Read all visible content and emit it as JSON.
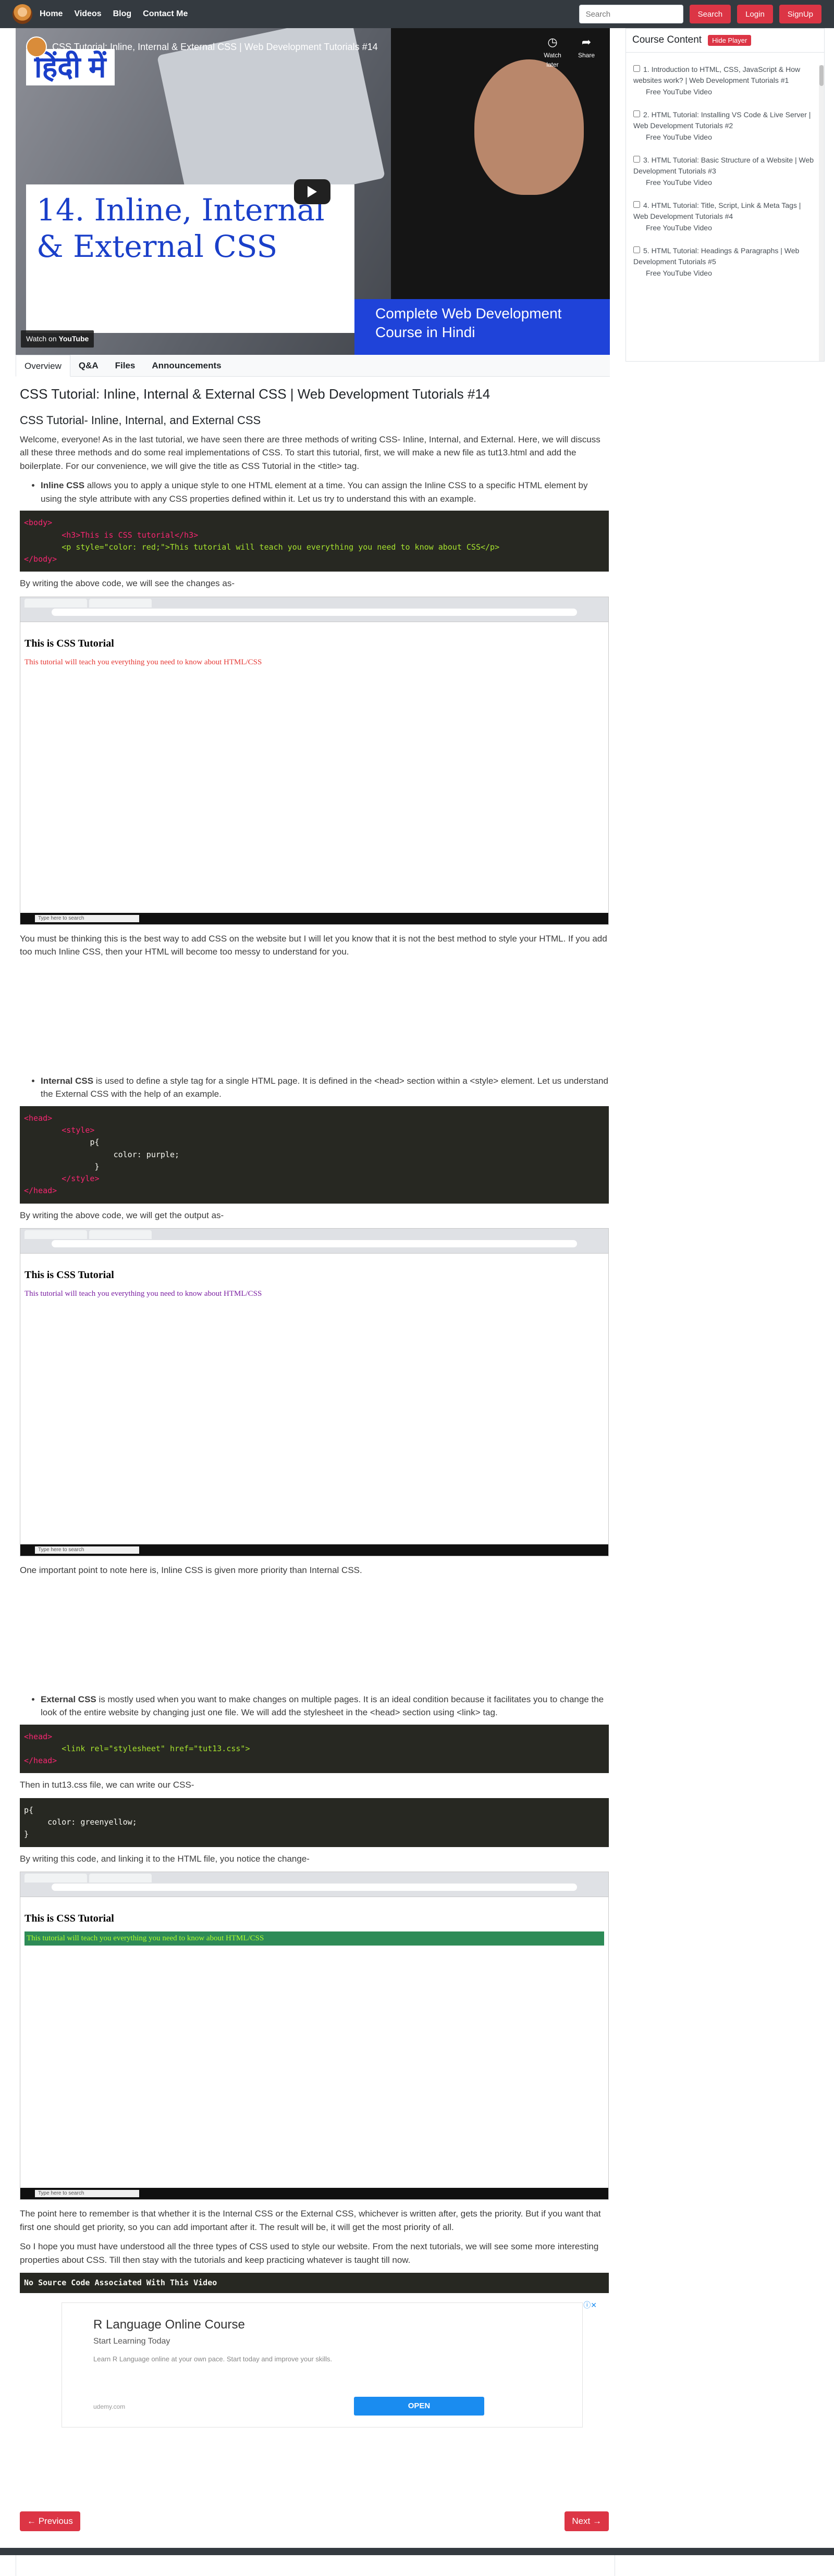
{
  "nav": {
    "links": [
      "Home",
      "Videos",
      "Blog",
      "Contact Me"
    ],
    "search_placeholder": "Search",
    "search_button": "Search",
    "login_button": "Login",
    "signup_button": "SignUp"
  },
  "video": {
    "overlay_title": "CSS Tutorial: Inline, Internal & External CSS | Web Development Tutorials #14",
    "hindi_tag": "हिंदी में",
    "big_title": "14. Inline, Internal & External CSS",
    "course_hindi": "Complete Web Development Course in Hindi",
    "watch_on": "Watch on",
    "youtube": "YouTube",
    "watch_later": "Watch later",
    "share": "Share"
  },
  "sidebar": {
    "title": "Course Content",
    "hide_button": "Hide Player",
    "lessons": [
      {
        "title": "1. Introduction to HTML, CSS, JavaScript & How websites work? | Web Development Tutorials #1",
        "sub": "Free YouTube Video"
      },
      {
        "title": "2. HTML Tutorial: Installing VS Code & Live Server | Web Development Tutorials #2",
        "sub": "Free YouTube Video"
      },
      {
        "title": "3. HTML Tutorial: Basic Structure of a Website | Web Development Tutorials #3",
        "sub": "Free YouTube Video"
      },
      {
        "title": "4. HTML Tutorial: Title, Script, Link & Meta Tags | Web Development Tutorials #4",
        "sub": "Free YouTube Video"
      },
      {
        "title": "5. HTML Tutorial: Headings & Paragraphs | Web Development Tutorials #5",
        "sub": "Free YouTube Video"
      }
    ]
  },
  "tabs": [
    "Overview",
    "Q&A",
    "Files",
    "Announcements"
  ],
  "article": {
    "title": "CSS Tutorial: Inline, Internal & External CSS | Web Development Tutorials #14",
    "subtitle": "CSS Tutorial- Inline, Internal, and External CSS",
    "intro": "Welcome, everyone! As in the last tutorial, we have seen there are three methods of writing CSS- Inline, Internal, and External. Here, we will discuss all these three methods and do some real implementations of CSS. To start this tutorial, first, we will make a new file as tut13.html and add the boilerplate. For our convenience, we will give the title as CSS Tutorial in the <title> tag.",
    "inline_bold": "Inline CSS",
    "inline_text": " allows you to apply a unique style to one HTML element at a time. You can assign the Inline CSS to a specific HTML element by using the style attribute with any CSS properties defined within it. Let us try to understand this with an example.",
    "code1": [
      "<body>",
      "<h3>This is CSS tutorial</h3>",
      "<p style=\"color: red;\">This tutorial will teach you everything you need to know about CSS</p>",
      "</body>"
    ],
    "after_code1": "By writing the above code, we will see the changes as-",
    "shot1_h": "This is CSS Tutorial",
    "shot1_p": "This tutorial will teach you everything you need to know about HTML/CSS",
    "taskbar_search": "Type here to search",
    "inline_note": "You must be thinking this is the best way to add CSS on the website but I will let you know that it is not the best method to style your HTML. If you add too much Inline CSS, then your HTML will become too messy to understand for you.",
    "internal_bold": "Internal CSS",
    "internal_text": " is used to define a style tag for a single HTML page. It is defined in the <head> section within a <style> element. Let us understand the External CSS with the help of an example.",
    "code2": [
      "<head>",
      "<style>",
      "p{",
      "color: purple;",
      "}",
      "</style>",
      "</head>"
    ],
    "after_code2": "By writing the above code, we will get the output as-",
    "shot2_h": "This is CSS Tutorial",
    "shot2_p": "This tutorial will teach you everything you need to know about HTML/CSS",
    "priority_note": "One important point to note here is, Inline CSS is given more priority than Internal CSS.",
    "external_bold": "External CSS",
    "external_text": " is mostly used when you want to make changes on multiple pages. It is an ideal condition because it facilitates you to change the look of the entire website by changing just one file. We will add the stylesheet in the <head> section using <link> tag.",
    "code3": [
      "<head>",
      "<link rel=\"stylesheet\" href=\"tut13.css\">",
      "</head>"
    ],
    "then_text": "Then in tut13.css file, we can write our CSS-",
    "code4": [
      "p{",
      "color: greenyellow;",
      "}"
    ],
    "after_code4": "By writing this code, and linking it to the HTML file, you notice the change-",
    "shot3_h": "This is CSS Tutorial",
    "shot3_p": "This tutorial will teach you everything you need to know about HTML/CSS",
    "remember_text": "The point here to remember is that whether it is the Internal CSS or the External CSS, whichever is written after, gets the priority. But if you want that first one should get priority, so you can add important after it. The result will be, it will get the most priority of all.",
    "closing_text": "So I hope you must have understood all the three types of CSS used to style our website. From the next tutorials, we will see some more interesting properties about CSS. Till then stay with the tutorials and keep practicing whatever is taught till now.",
    "no_source": "No Source Code Associated With This Video"
  },
  "ad": {
    "title": "R Language Online Course",
    "subtitle": "Start Learning Today",
    "desc": "Learn R Language online at your own pace. Start today and improve your skills.",
    "url": "udemy.com",
    "open": "OPEN"
  },
  "pager": {
    "prev": "← Previous",
    "next": "Next →"
  }
}
